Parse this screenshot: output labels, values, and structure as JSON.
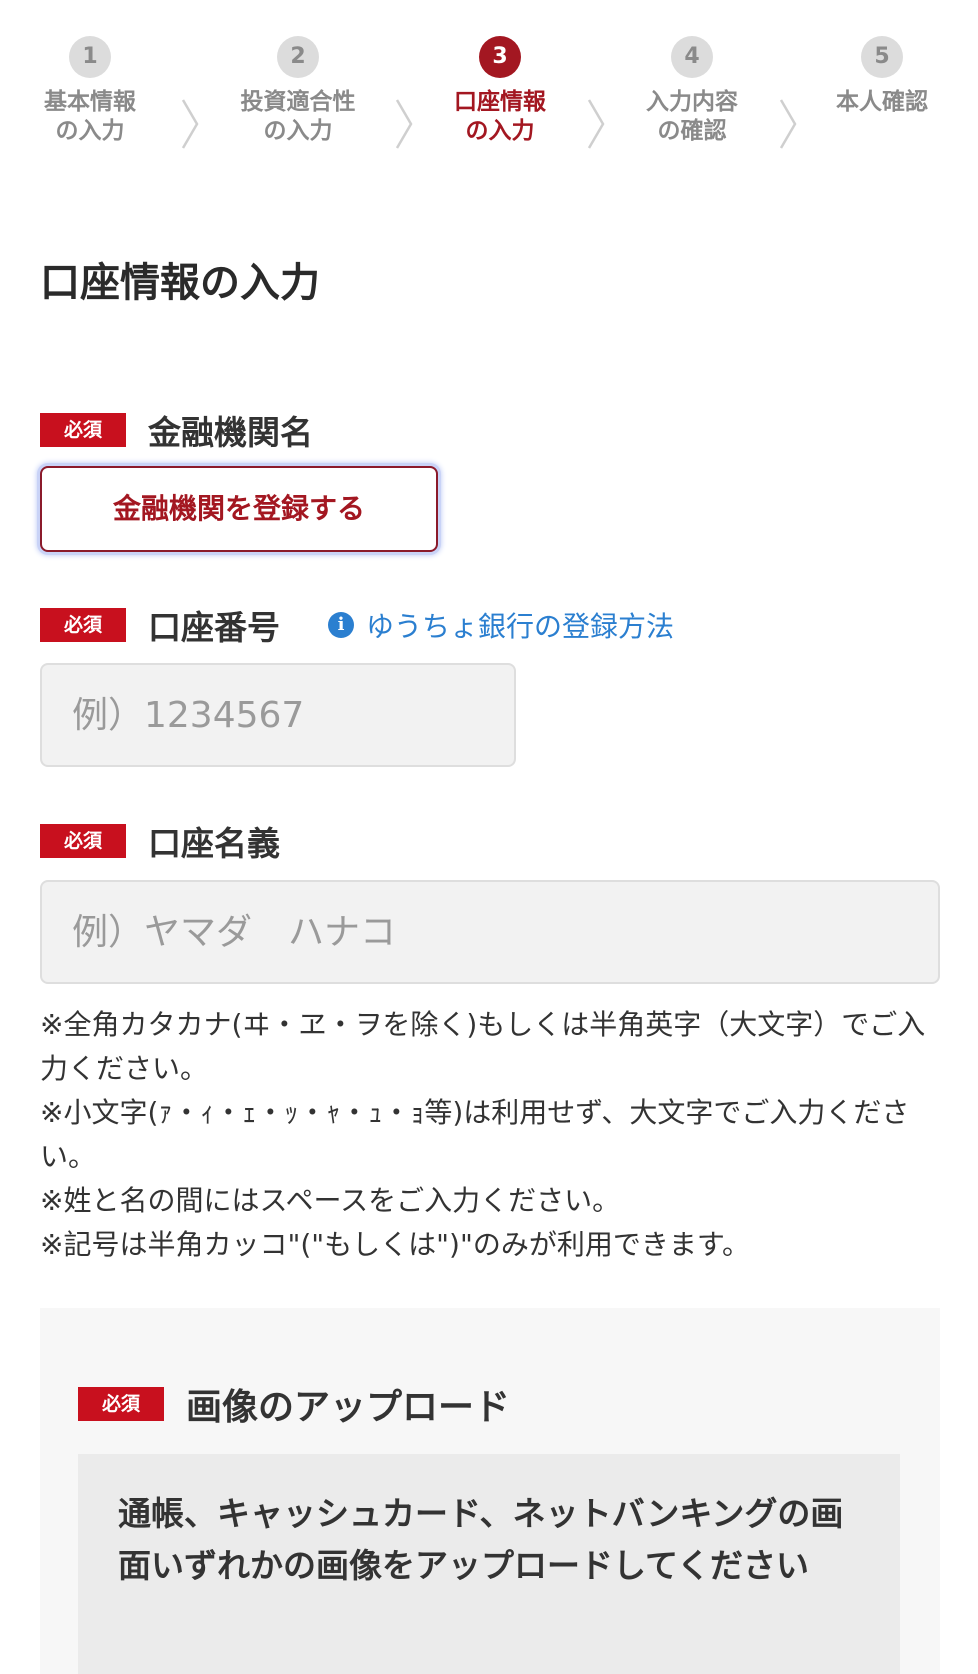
{
  "stepper": {
    "steps": [
      {
        "number": "1",
        "label": "基本情報\nの入力"
      },
      {
        "number": "2",
        "label": "投資適合性\nの入力"
      },
      {
        "number": "3",
        "label": "口座情報\nの入力"
      },
      {
        "number": "4",
        "label": "入力内容\nの確認"
      },
      {
        "number": "5",
        "label": "本人確認"
      }
    ],
    "active_step": 3
  },
  "page": {
    "title": "口座情報の入力"
  },
  "required_badge": "必須",
  "bank": {
    "label": "金融機関名",
    "register_button": "金融機関を登録する"
  },
  "account_number": {
    "label": "口座番号",
    "help_link": "ゆうちょ銀行の登録方法",
    "placeholder": "例）1234567"
  },
  "account_name": {
    "label": "口座名義",
    "placeholder": "例）ヤマダ　ハナコ"
  },
  "notes": [
    "※全角カタカナ(ヰ・ヱ・ヲを除く)もしくは半角英字（大文字）でご入力ください。",
    "※小文字(ｧ・ｨ・ｪ・ｯ・ｬ・ｭ・ｮ等)は利用せず、大文字でご入力ください。",
    "※姓と名の間にはスペースをご入力ください。",
    "※記号は半角カッコ\"(\"もしくは\")\"のみが利用できます。"
  ],
  "upload": {
    "label": "画像のアップロード",
    "instruction": "通帳、キャッシュカード、ネットバンキングの画面いずれかの画像をアップロードしてください"
  },
  "colors": {
    "brand_red": "#a31721",
    "badge_red": "#c8101e",
    "link_blue": "#2b7fd0",
    "inactive_gray": "#8a8a8a"
  }
}
